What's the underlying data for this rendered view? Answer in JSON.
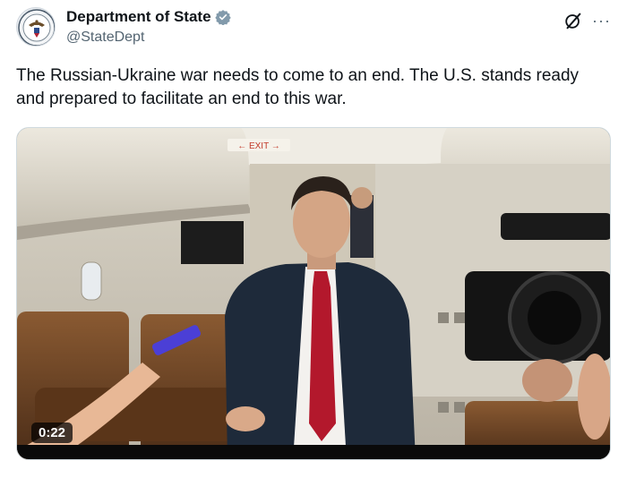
{
  "post": {
    "author": {
      "display_name": "Department of State",
      "handle": "@StateDept",
      "verified_icon": "verified-badge-icon",
      "verified_color": "#829aab"
    },
    "text": "The Russian-Ukraine war needs to come to an end.  The U.S. stands ready and prepared to facilitate an end to this war.",
    "media": {
      "type": "video",
      "duration": "0:22",
      "exit_sign": "← EXIT →"
    },
    "actions": {
      "grok_icon": "grok-icon",
      "more_icon": "more-dots-icon",
      "more_label": "···"
    }
  },
  "colors": {
    "text_primary": "#0f1419",
    "text_secondary": "#536471",
    "tie_red": "#b3182c",
    "suit": "#1e2a3a"
  }
}
